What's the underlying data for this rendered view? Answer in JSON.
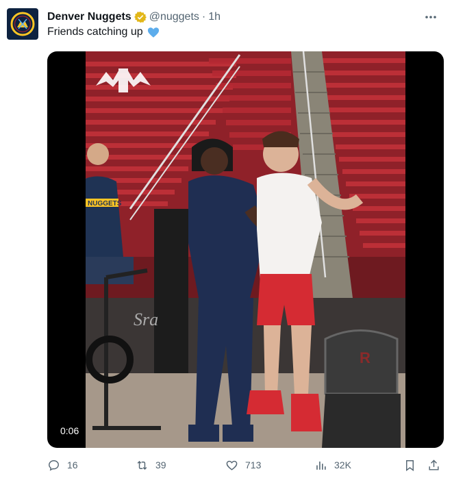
{
  "tweet": {
    "author_name": "Denver Nuggets",
    "handle": "@nuggets",
    "separator": "·",
    "time": "1h",
    "text": "Friends catching up",
    "text_emoji": "blue-heart",
    "more_label": "•••"
  },
  "media": {
    "type": "video",
    "duration": "0:06",
    "jersey_text": "NUGGETS",
    "bg_text": "Sra"
  },
  "actions": {
    "replies": "16",
    "retweets": "39",
    "likes": "713",
    "views": "32K"
  },
  "colors": {
    "brand_navy": "#0d2240",
    "nuggets_gold": "#fec524",
    "verified_gold": "#e2b719",
    "heart_blue": "#5dadec",
    "muted_text": "#536471",
    "arena_red": "#b3242c"
  },
  "icons": [
    "nuggets-logo-icon",
    "verified-icon",
    "more-icon",
    "blue-heart-icon",
    "reply-icon",
    "retweet-icon",
    "like-icon",
    "views-icon",
    "bookmark-icon",
    "share-icon"
  ]
}
